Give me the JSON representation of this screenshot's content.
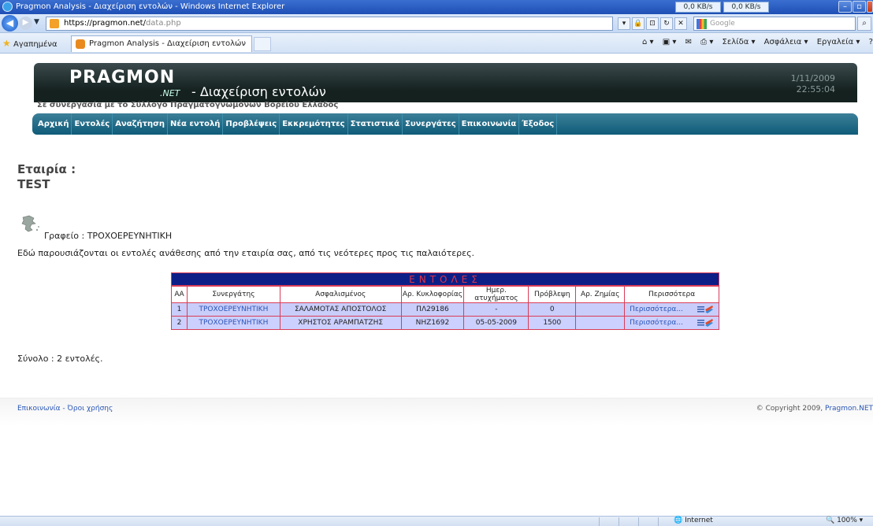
{
  "browser": {
    "window_title": "Pragmon Analysis - Διαχείριση εντολών - Windows Internet Explorer",
    "speed_down": "0,0 KB/s",
    "speed_up": "0,0 KB/s",
    "address_secure": "https://pragmon.net/",
    "address_path": "data.php",
    "search_placeholder": "Google",
    "favorites_label": "Αγαπημένα",
    "tab_title": "Pragmon Analysis - Διαχείριση εντολών",
    "cmd_page": "Σελίδα ▾",
    "cmd_safety": "Ασφάλεια ▾",
    "cmd_tools": "Εργαλεία ▾",
    "status_zone": "Internet",
    "status_zoom": "100%"
  },
  "header": {
    "logo": "PRAGMON",
    "logo_sub": ".NET",
    "title": "- Διαχείριση εντολών",
    "date": "1/11/2009",
    "time": "22:55:04",
    "subtitle": "Σε συνεργασία με το Σύλλογο Πραγματογνωμόνων Βορείου Ελλάδος"
  },
  "menu": [
    "Αρχική",
    "Εντολές",
    "Αναζήτηση",
    "Νέα εντολή",
    "Προβλέψεις",
    "Εκκρεμότητες",
    "Στατιστικά",
    "Συνεργάτες",
    "Επικοινωνία",
    "Έξοδος"
  ],
  "company": {
    "label": "Εταιρία :",
    "name": "TEST"
  },
  "office": "Γραφείο : ΤΡΟΧΟΕΡΕΥΝΗΤΙΚΗ",
  "description": "Εδώ παρουσιάζονται οι εντολές ανάθεσης από την εταιρία σας, από τις νεότερες προς τις παλαιότερες.",
  "table": {
    "caption": "ΕΝΤΟΛΕΣ",
    "headers": [
      "ΑΑ",
      "Συνεργάτης",
      "Ασφαλισμένος",
      "Αρ. Κυκλοφορίας",
      "Ημερ. ατυχήματος",
      "Πρόβλεψη",
      "Αρ. Ζημίας",
      "Περισσότερα"
    ],
    "rows": [
      {
        "aa": "1",
        "partner": "ΤΡΟΧΟΕΡΕΥΝΗΤΙΚΗ",
        "insured": "ΣΑΛΑΜΟΤΑΣ ΑΠΟΣΤΟΛΟΣ",
        "plate": "ΠΛ29186",
        "date": "-",
        "forecast": "0",
        "claim": "",
        "more": "Περισσότερα..."
      },
      {
        "aa": "2",
        "partner": "ΤΡΟΧΟΕΡΕΥΝΗΤΙΚΗ",
        "insured": "ΧΡΗΣΤΟΣ ΑΡΑΜΠΑΤΖΗΣ",
        "plate": "ΝΗΖ1692",
        "date": "05-05-2009",
        "forecast": "1500",
        "claim": "",
        "more": "Περισσότερα..."
      }
    ]
  },
  "total": "Σύνολο : 2 εντολές.",
  "footer": {
    "left": "Επικοινωνία - Όροι χρήσης",
    "right_prefix": "© Copyright 2009,",
    "right_link": "Pragmon.NET"
  }
}
